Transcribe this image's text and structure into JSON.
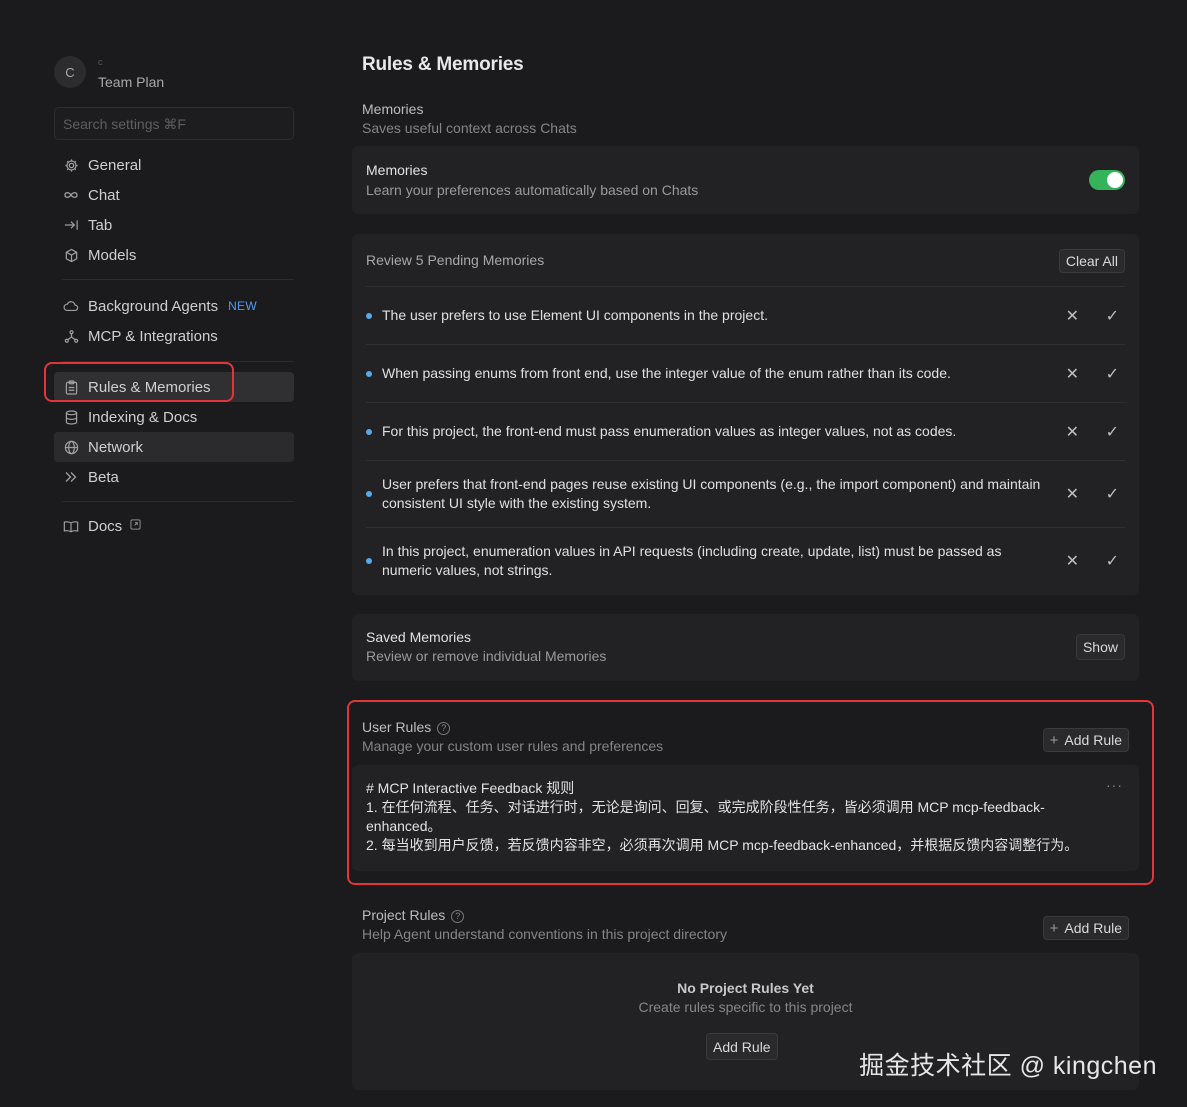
{
  "profile": {
    "avatar_letter": "C",
    "email": "c",
    "plan": "Team Plan"
  },
  "search": {
    "placeholder": "Search settings ⌘F"
  },
  "nav": {
    "general": "General",
    "chat": "Chat",
    "tab": "Tab",
    "models": "Models",
    "background_agents": "Background Agents",
    "background_badge": "NEW",
    "mcp": "MCP & Integrations",
    "rules": "Rules & Memories",
    "indexing": "Indexing & Docs",
    "network": "Network",
    "beta": "Beta",
    "docs": "Docs"
  },
  "page": {
    "title": "Rules & Memories"
  },
  "memories_section": {
    "title": "Memories",
    "desc": "Saves useful context across Chats"
  },
  "memories_card": {
    "title": "Memories",
    "desc": "Learn your preferences automatically based on Chats",
    "enabled": true
  },
  "pending": {
    "heading": "Review 5 Pending Memories",
    "clear_label": "Clear All",
    "items": [
      "The user prefers to use Element UI components in the project.",
      "When passing enums from front end, use the integer value of the enum rather than its code.",
      "For this project, the front-end must pass enumeration values as integer values, not as codes.",
      "User prefers that front-end pages reuse existing UI components (e.g., the import component) and maintain consistent UI style with the existing system.",
      "In this project, enumeration values in API requests (including create, update, list) must be passed as numeric values, not strings."
    ]
  },
  "saved": {
    "title": "Saved Memories",
    "desc": "Review or remove individual Memories",
    "show_label": "Show"
  },
  "user_rules": {
    "title": "User Rules",
    "desc": "Manage your custom user rules and preferences",
    "add_label": "Add Rule",
    "rule": {
      "line1": "# MCP Interactive Feedback 规则",
      "line2": "1. 在任何流程、任务、对话进行时，无论是询问、回复、或完成阶段性任务，皆必须调用 MCP mcp-feedback-enhanced。",
      "line3": "2. 每当收到用户反馈，若反馈内容非空，必须再次调用 MCP mcp-feedback-enhanced，并根据反馈内容调整行为。"
    }
  },
  "project_rules": {
    "title": "Project Rules",
    "desc": "Help Agent understand conventions in this project directory",
    "add_label": "Add Rule",
    "empty_title": "No Project Rules Yet",
    "empty_desc": "Create rules specific to this project",
    "empty_button": "Add Rule"
  },
  "watermark": "掘金技术社区 @ kingchen",
  "colors": {
    "accent_toggle": "#34b35a",
    "highlight": "#e0353a",
    "badge": "#4c9cf5",
    "dot": "#5aa9e6"
  }
}
